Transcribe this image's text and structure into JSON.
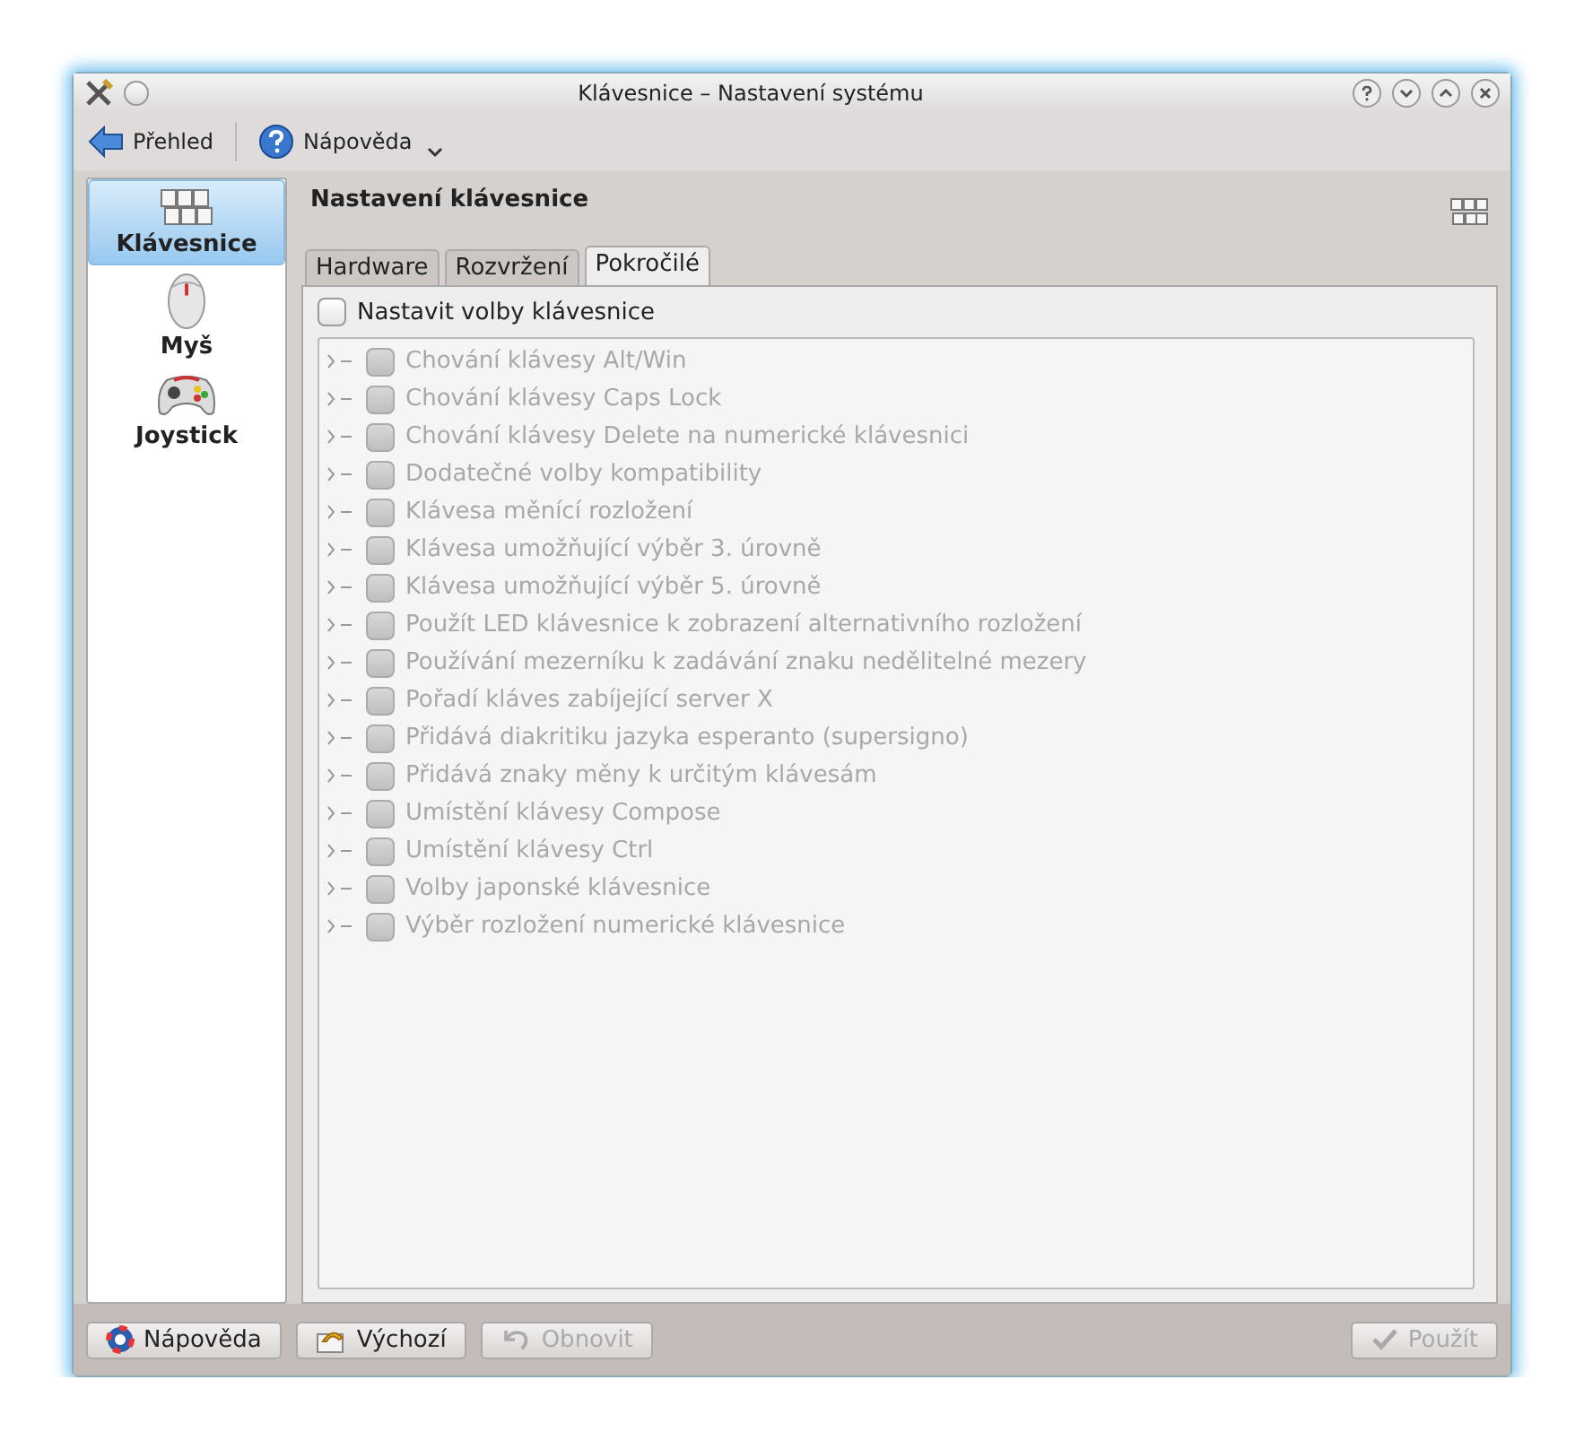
{
  "window": {
    "title": "Klávesnice – Nastavení systému"
  },
  "toolbar": [
    {
      "label": "Přehled",
      "kind": "back"
    },
    {
      "label": "Nápověda",
      "kind": "help",
      "menu": true
    }
  ],
  "sidebar": {
    "items": [
      {
        "label": "Klávesnice",
        "kind": "keyboard",
        "selected": true
      },
      {
        "label": "Myš",
        "kind": "mouse",
        "selected": false
      },
      {
        "label": "Joystick",
        "kind": "joystick",
        "selected": false
      }
    ]
  },
  "page": {
    "title": "Nastavení klávesnice"
  },
  "tabs": [
    {
      "label": "Hardware",
      "selected": false
    },
    {
      "label": "Rozvržení",
      "selected": false
    },
    {
      "label": "Pokročilé",
      "selected": true
    }
  ],
  "configure": {
    "label": "Nastavit volby klávesnice",
    "checked": false
  },
  "options": {
    "disabled": true,
    "items": [
      {
        "label": "Chování klávesy Alt/Win",
        "checked": false,
        "expanded": false
      },
      {
        "label": "Chování klávesy Caps Lock",
        "checked": false,
        "expanded": false
      },
      {
        "label": "Chování klávesy Delete na numerické klávesnici",
        "checked": false,
        "expanded": false
      },
      {
        "label": "Dodatečné volby kompatibility",
        "checked": false,
        "expanded": false
      },
      {
        "label": "Klávesa měnící rozložení",
        "checked": false,
        "expanded": false
      },
      {
        "label": "Klávesa umožňující výběr 3. úrovně",
        "checked": false,
        "expanded": false
      },
      {
        "label": "Klávesa umožňující výběr 5. úrovně",
        "checked": false,
        "expanded": false
      },
      {
        "label": "Použít LED klávesnice k zobrazení alternativního rozložení",
        "checked": false,
        "expanded": false
      },
      {
        "label": "Používání mezerníku k zadávání znaku nedělitelné mezery",
        "checked": false,
        "expanded": false
      },
      {
        "label": "Pořadí kláves zabíjející server X",
        "checked": false,
        "expanded": false
      },
      {
        "label": "Přidává diakritiku jazyka esperanto (supersigno)",
        "checked": false,
        "expanded": false
      },
      {
        "label": "Přidává znaky měny k určitým klávesám",
        "checked": false,
        "expanded": false
      },
      {
        "label": "Umístění klávesy Compose",
        "checked": false,
        "expanded": false
      },
      {
        "label": "Umístění klávesy Ctrl",
        "checked": false,
        "expanded": false
      },
      {
        "label": "Volby japonské klávesnice",
        "checked": false,
        "expanded": false
      },
      {
        "label": "Výběr rozložení numerické klávesnice",
        "checked": false,
        "expanded": false
      }
    ]
  },
  "buttons": [
    {
      "label": "Nápověda",
      "kind": "help",
      "disabled": false
    },
    {
      "label": "Výchozí",
      "kind": "defaults",
      "disabled": false
    },
    {
      "label": "Obnovit",
      "kind": "reset",
      "disabled": true
    },
    {
      "label": "Použít",
      "kind": "apply",
      "disabled": true
    }
  ]
}
